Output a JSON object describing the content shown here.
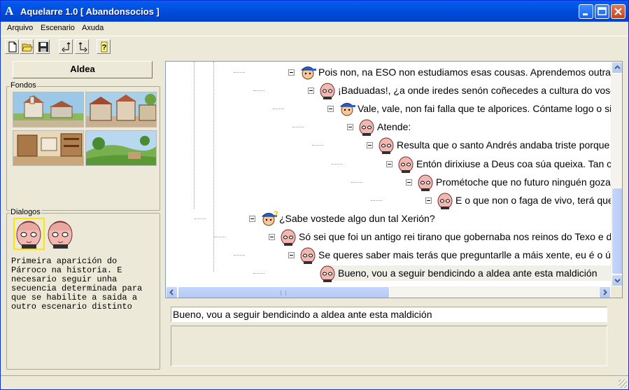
{
  "window": {
    "title": "Aquelarre 1.0 [ Abandonsocios ]",
    "app_icon": "A",
    "controls": [
      "minimize-icon",
      "maximize-icon",
      "close-icon"
    ]
  },
  "menu": [
    "Arquivo",
    "Escenario",
    "Axuda"
  ],
  "toolbar": [
    {
      "name": "new-file-icon"
    },
    {
      "name": "open-folder-icon"
    },
    {
      "name": "save-icon"
    },
    {
      "name": "back-icon"
    },
    {
      "name": "forward-icon"
    },
    {
      "name": "help-icon",
      "glyph": "?"
    }
  ],
  "left": {
    "scene_button": "Aldea",
    "fondos_label": "Fondos",
    "dialogos_label": "Dialogos",
    "description": "Primeira aparición do\nPárroco na historia. E\nnecesario seguir unha\nsecuencia determinada para\nque se habilite a saida a\noutro escenario distinto"
  },
  "tree": {
    "nodes": [
      {
        "text": "Pois non, na ESO non estudiamos esas cousas. Aprendemos outras cou",
        "speaker": "boy",
        "level": 3
      },
      {
        "text": "¡Baduadas!, ¿a onde iredes senón coñecedes a cultura do voso pol",
        "speaker": "priest",
        "level": 4
      },
      {
        "text": "Vale, vale, non fai falla que te alporices. Cóntame logo o signifi",
        "speaker": "boy",
        "level": 5
      },
      {
        "text": "Atende:",
        "speaker": "priest",
        "level": 6
      },
      {
        "text": "Resulta que o santo Andrés andaba triste porque todos",
        "speaker": "priest",
        "level": 7
      },
      {
        "text": "Entón dirixiuse a Deus coa súa queixa. Tan conmov",
        "speaker": "priest",
        "level": 8
      },
      {
        "text": "Prométoche que no futuro ninguén gozará do Re",
        "speaker": "priest",
        "level": 9
      },
      {
        "text": "E o que non o faga de vivo, terá que face-lo",
        "speaker": "priest",
        "level": 10
      },
      {
        "text": "¿Sabe vostede algo dun tal Xerión?",
        "speaker": "boy-question",
        "level": 1
      },
      {
        "text": "Só sei que foi un antigo rei tirano que gobernaba nos reinos do Texo e do D",
        "speaker": "priest",
        "level": 2
      },
      {
        "text": "Se queres saber mais terás que preguntarlle a máis xente, eu é o único",
        "speaker": "priest",
        "level": 3
      },
      {
        "text": "Bueno, vou a seguir bendicindo a aldea ante esta maldición",
        "speaker": "priest",
        "level": 4
      }
    ],
    "selected_index": 11
  },
  "editor": {
    "current_text": "Bueno, vou a seguir bendicindo a aldea ante esta maldición"
  },
  "colors": {
    "titlebar": "#0058e6",
    "selection_outline": "#ffe600",
    "face_skin": "#f0b8b0"
  }
}
